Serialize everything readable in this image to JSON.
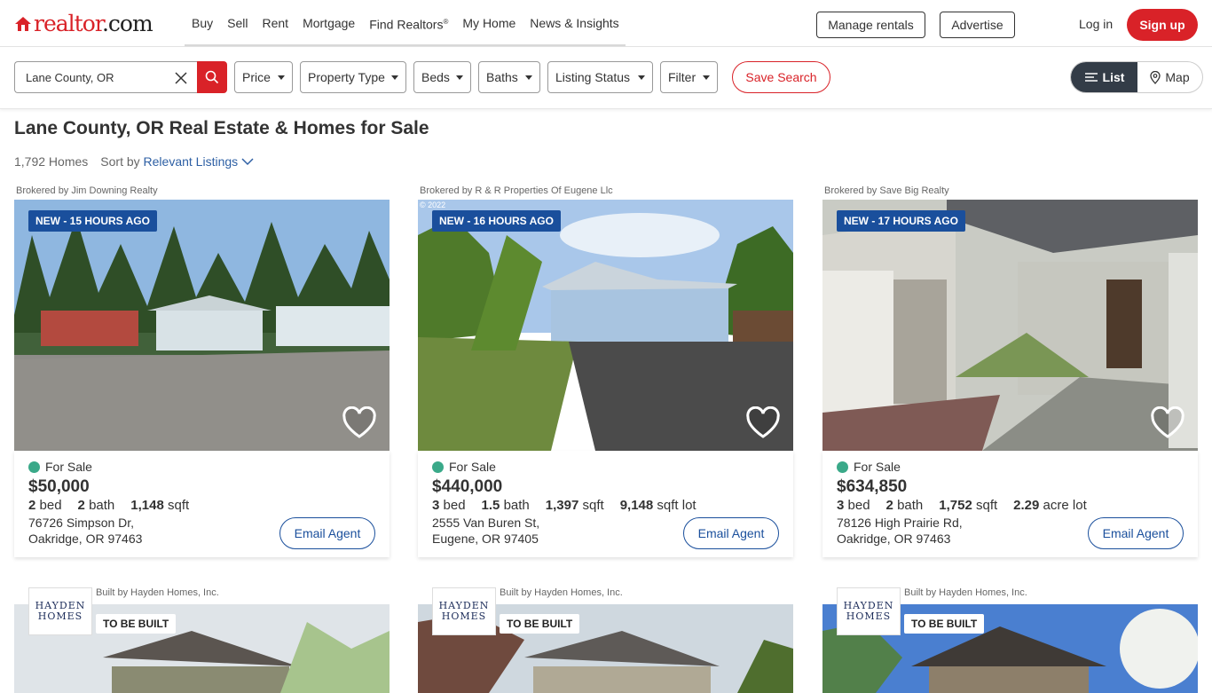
{
  "brand": {
    "name_red": "realtor",
    "name_dark": ".com"
  },
  "nav": {
    "links": [
      "Buy",
      "Sell",
      "Rent",
      "Mortgage",
      "Find Realtors",
      "My Home",
      "News & Insights"
    ],
    "find_realtors_sup": "®",
    "manage_rentals": "Manage rentals",
    "advertise": "Advertise",
    "login": "Log in",
    "signup": "Sign up"
  },
  "search": {
    "value": "Lane County, OR"
  },
  "filters": [
    "Price",
    "Property Type",
    "Beds",
    "Baths",
    "Listing Status",
    "Filter"
  ],
  "save_search": "Save Search",
  "view_toggle": {
    "list": "List",
    "map": "Map"
  },
  "page": {
    "title": "Lane County, OR Real Estate & Homes for Sale",
    "count": "1,792 Homes",
    "sort_label": "Sort by",
    "sort_value": "Relevant Listings"
  },
  "listings": [
    {
      "broker": "Brokered by Jim Downing Realty",
      "badge": "NEW - 15 HOURS AGO",
      "status": "For Sale",
      "price": "$50,000",
      "beds": "2",
      "beds_label": "bed",
      "baths": "2",
      "baths_label": "bath",
      "sqft": "1,148",
      "sqft_label": "sqft",
      "lot": "",
      "lot_label": "",
      "addr1": "76726 Simpson Dr,",
      "addr2": "Oakridge, OR 97463",
      "cta": "Email Agent"
    },
    {
      "broker": "Brokered by R & R Properties Of Eugene Llc",
      "badge": "NEW - 16 HOURS AGO",
      "watermark": "© 2022",
      "status": "For Sale",
      "price": "$440,000",
      "beds": "3",
      "beds_label": "bed",
      "baths": "1.5",
      "baths_label": "bath",
      "sqft": "1,397",
      "sqft_label": "sqft",
      "lot": "9,148",
      "lot_label": "sqft lot",
      "addr1": "2555 Van Buren St,",
      "addr2": "Eugene, OR 97405",
      "cta": "Email Agent"
    },
    {
      "broker": "Brokered by Save Big Realty",
      "badge": "NEW - 17 HOURS AGO",
      "status": "For Sale",
      "price": "$634,850",
      "beds": "3",
      "beds_label": "bed",
      "baths": "2",
      "baths_label": "bath",
      "sqft": "1,752",
      "sqft_label": "sqft",
      "lot": "2.29",
      "lot_label": "acre lot",
      "addr1": "78126 High Prairie Rd,",
      "addr2": "Oakridge, OR 97463",
      "cta": "Email Agent"
    }
  ],
  "builder_listings": [
    {
      "builder": "Built by Hayden Homes, Inc.",
      "badge": "TO BE BUILT",
      "logo_l1": "HAYDEN",
      "logo_l2": "HOMES"
    },
    {
      "builder": "Built by Hayden Homes, Inc.",
      "badge": "TO BE BUILT",
      "logo_l1": "HAYDEN",
      "logo_l2": "HOMES"
    },
    {
      "builder": "Built by Hayden Homes, Inc.",
      "badge": "TO BE BUILT",
      "logo_l1": "HAYDEN",
      "logo_l2": "HOMES"
    }
  ],
  "icons": [
    "house-logo-icon",
    "clear-icon",
    "search-icon",
    "caret-down-icon",
    "list-icon",
    "map-pin-icon",
    "chevron-down-icon",
    "heart-icon",
    "status-dot-icon"
  ],
  "colors": {
    "brand_red": "#d92228",
    "link_blue": "#2d5fa4",
    "badge_blue": "#1a4f9c",
    "for_sale_green": "#3aa989",
    "toggle_dark": "#333c47"
  }
}
